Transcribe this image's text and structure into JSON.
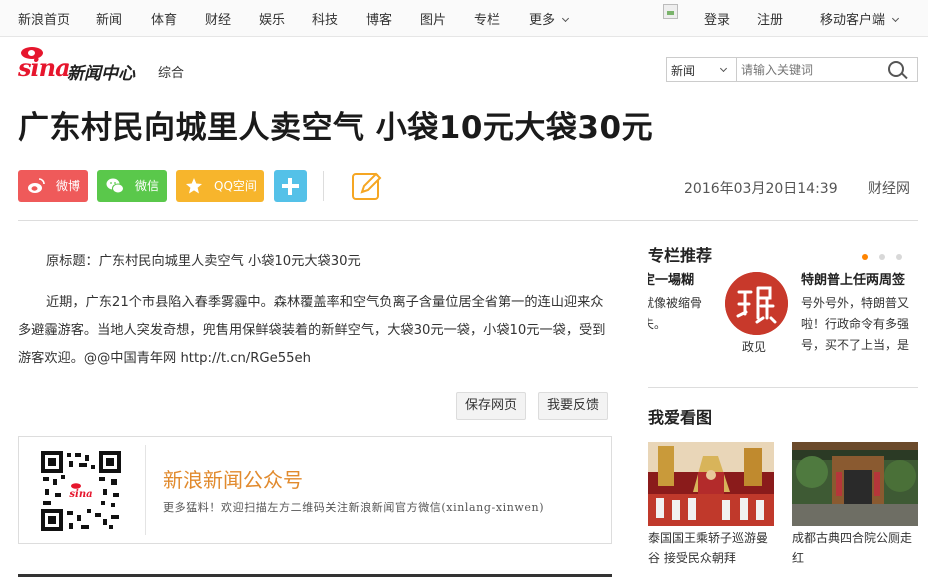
{
  "topnav": {
    "items": [
      "新浪首页",
      "新闻",
      "体育",
      "财经",
      "娱乐",
      "科技",
      "博客",
      "图片",
      "专栏",
      "更多"
    ],
    "login": "登录",
    "register": "注册",
    "mobile": "移动客户端"
  },
  "header": {
    "logo_text": "sina",
    "channel": "新闻中心",
    "section": "综合",
    "search": {
      "scope": "新闻",
      "placeholder": "请输入关键词"
    }
  },
  "article": {
    "title": "广东村民向城里人卖空气 小袋10元大袋30元",
    "share": {
      "weibo": "微博",
      "weixin": "微信",
      "qzone": "QQ空间"
    },
    "date": "2016年03月20日14:39",
    "source": "财经网",
    "original_title": "原标题：广东村民向城里人卖空气 小袋10元大袋30元",
    "body": "近期，广东21个市县陷入春季雾霾中。森林覆盖率和空气负离子含量位居全省第一的连山迎来众多避霾游客。当地人突发奇想，兜售用保鲜袋装着的新鲜空气，大袋30元一袋，小袋10元一袋，受到游客欢迎。@@中国青年网 http://t.cn/RGe55eh",
    "buttons": {
      "save": "保存网页",
      "feedback": "我要反馈"
    },
    "wechat_promo": {
      "title": "新浪新闻公众号",
      "desc": "更多猛料！欢迎扫描左方二维码关注新浪新闻官方微信(xinlang-xinwen)"
    }
  },
  "sidebar": {
    "column_title": "专栏推荐",
    "columns": {
      "left_title": "定一場糊",
      "left_text": [
        "就像被缩骨",
        "夫。"
      ],
      "author_name": "政见",
      "right_title": "特朗普上任两周签",
      "right_text": [
        "号外号外，特朗普又",
        "啦！行政命令有多强",
        "号，买不了上当，是"
      ]
    },
    "pics_title": "我爱看图",
    "pics": [
      {
        "caption": "泰国国王乘轿子巡游曼谷 接受民众朝拜"
      },
      {
        "caption": "成都古典四合院公厕走红"
      }
    ]
  },
  "colors": {
    "brand_red": "#e6162d",
    "weibo": "#ef5a5a",
    "weixin": "#5ac84b",
    "qzone": "#f7b52c",
    "more": "#54c1e8",
    "promo_orange": "#e18a2d",
    "dot_active": "#ff8400"
  }
}
